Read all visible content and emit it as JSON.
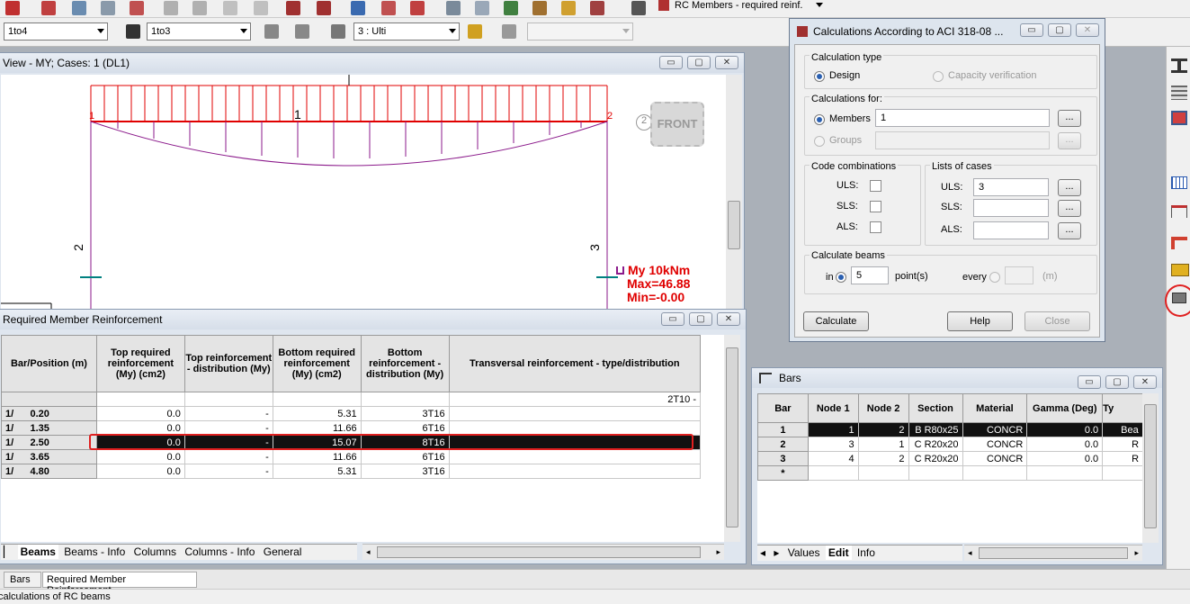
{
  "toolbar2": {
    "combo1": "1to4",
    "combo2": "1to3",
    "combo3": "3 : Ulti",
    "layout_combo": "RC Members - required reinf."
  },
  "view_window": {
    "title": "View - MY; Cases: 1 (DL1)",
    "front_label": "FRONT",
    "node_labels": [
      "1",
      "2",
      "2",
      "3"
    ],
    "member_labels": [
      "1",
      "2",
      "3"
    ],
    "legend_line1": "My  10kNm",
    "legend_line2": "Max=46.88",
    "legend_line3": "Min=-0.00",
    "colors": {
      "load": "#e00000",
      "diagram": "#8b1a8b",
      "frame": "#8b1a8b",
      "support": "#008080"
    }
  },
  "reinf_window": {
    "title": "Required Member Reinforcement",
    "columns": [
      "Bar/Position (m)",
      "Top required reinforcement (My) (cm2)",
      "Top reinforcement - distribution (My)",
      "Bottom required reinforcement (My) (cm2)",
      "Bottom reinforcement - distribution (My)",
      "Transversal reinforcement - type/distribution"
    ],
    "header_row_extra": "2T10 -",
    "rows": [
      {
        "bar": "1/",
        "pos": "0.20",
        "top": "0.0",
        "topd": "-",
        "bot": "5.31",
        "botd": "3T16"
      },
      {
        "bar": "1/",
        "pos": "1.35",
        "top": "0.0",
        "topd": "-",
        "bot": "11.66",
        "botd": "6T16"
      },
      {
        "bar": "1/",
        "pos": "2.50",
        "top": "0.0",
        "topd": "-",
        "bot": "15.07",
        "botd": "8T16"
      },
      {
        "bar": "1/",
        "pos": "3.65",
        "top": "0.0",
        "topd": "-",
        "bot": "11.66",
        "botd": "6T16"
      },
      {
        "bar": "1/",
        "pos": "4.80",
        "top": "0.0",
        "topd": "-",
        "bot": "5.31",
        "botd": "3T16"
      }
    ],
    "tabs": [
      "Beams",
      "Beams - Info",
      "Columns",
      "Columns - Info",
      "General"
    ],
    "active_tab": "Beams"
  },
  "aci_dialog": {
    "title": "Calculations According to ACI 318-08 ...",
    "calc_type_label": "Calculation type",
    "design_label": "Design",
    "capacity_label": "Capacity verification",
    "calc_for_label": "Calculations for:",
    "members_label": "Members",
    "members_value": "1",
    "groups_label": "Groups",
    "code_comb_label": "Code combinations",
    "uls_label": "ULS:",
    "sls_label": "SLS:",
    "als_label": "ALS:",
    "lists_label": "Lists of cases",
    "uls_value": "3",
    "calc_beams_label": "Calculate beams",
    "in_label": "in",
    "points_value": "5",
    "points_label": "point(s)",
    "every_label": "every",
    "m_label": "(m)",
    "dots": "...",
    "calculate_btn": "Calculate",
    "help_btn": "Help",
    "close_btn": "Close"
  },
  "bars_window": {
    "title": "Bars",
    "columns": [
      "Bar",
      "Node 1",
      "Node 2",
      "Section",
      "Material",
      "Gamma (Deg)",
      "Ty"
    ],
    "rows": [
      {
        "bar": "1",
        "n1": "1",
        "n2": "2",
        "section": "B R80x25",
        "material": "CONCR",
        "gamma": "0.0",
        "type": "Bea"
      },
      {
        "bar": "2",
        "n1": "3",
        "n2": "1",
        "section": "C R20x20",
        "material": "CONCR",
        "gamma": "0.0",
        "type": "R"
      },
      {
        "bar": "3",
        "n1": "4",
        "n2": "2",
        "section": "C R20x20",
        "material": "CONCR",
        "gamma": "0.0",
        "type": "R"
      }
    ],
    "new_row": "*",
    "tabs": [
      "Values",
      "Edit",
      "Info"
    ],
    "active_tab": "Edit"
  },
  "taskbar": {
    "items": [
      "Bars",
      "Required Member Reinforcement"
    ]
  },
  "status_bar": {
    "text": "calculations of RC beams"
  }
}
